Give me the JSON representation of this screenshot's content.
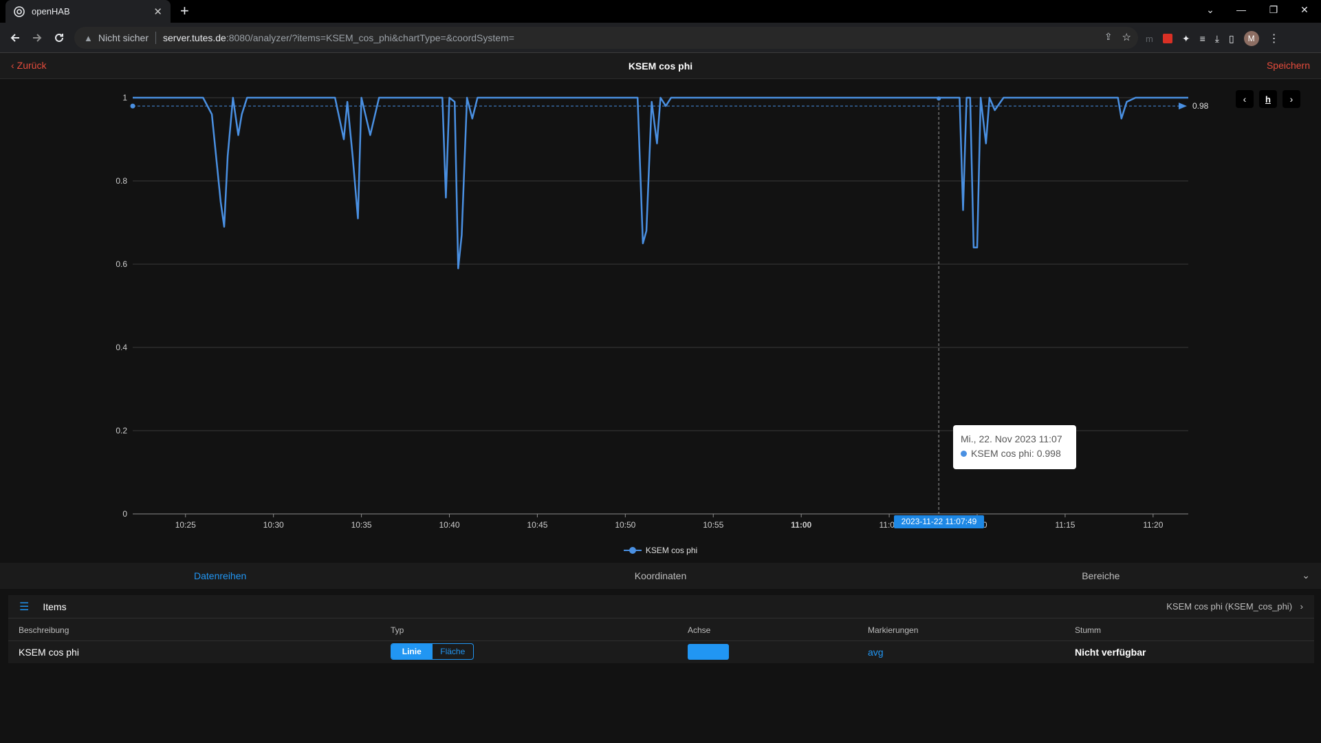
{
  "browser": {
    "tab_title": "openHAB",
    "insecure_label": "Nicht sicher",
    "url_host": "server.tutes.de",
    "url_path": ":8080/analyzer/?items=KSEM_cos_phi&chartType=&coordSystem=",
    "profile_initial": "M"
  },
  "nav": {
    "back_label": "Zurück",
    "title": "KSEM cos phi",
    "save_label": "Speichern"
  },
  "chart_controls": {
    "prev": "‹",
    "period": "h",
    "next": "›"
  },
  "chart_data": {
    "type": "line",
    "title": "",
    "xlabel": "",
    "ylabel": "",
    "ylim": [
      0,
      1
    ],
    "y_ticks": [
      "0",
      "0.2",
      "0.4",
      "0.6",
      "0.8",
      "1"
    ],
    "x_ticks": [
      "10:25",
      "10:30",
      "10:35",
      "10:40",
      "10:45",
      "10:50",
      "10:55",
      "11:00",
      "11:05",
      "11:10",
      "11:15",
      "11:20"
    ],
    "x_range": [
      "10:22",
      "11:22"
    ],
    "series": [
      {
        "name": "KSEM cos phi",
        "color": "#4a90e2",
        "x": [
          "10:22",
          "10:26",
          "10:26.5",
          "10:27",
          "10:27.2",
          "10:27.4",
          "10:27.7",
          "10:28",
          "10:28.2",
          "10:28.5",
          "10:29",
          "10:33.5",
          "10:34",
          "10:34.2",
          "10:34.5",
          "10:34.8",
          "10:35",
          "10:35.5",
          "10:36",
          "10:37",
          "10:39.6",
          "10:39.8",
          "10:40",
          "10:40.3",
          "10:40.5",
          "10:40.7",
          "10:41",
          "10:41.3",
          "10:41.6",
          "10:42",
          "10:50.7",
          "10:51",
          "10:51.2",
          "10:51.5",
          "10:51.8",
          "10:52",
          "10:52.3",
          "10:52.6",
          "10:53",
          "11:09",
          "11:09.2",
          "11:09.4",
          "11:09.6",
          "11:09.8",
          "11:10",
          "11:10.2",
          "11:10.5",
          "11:10.7",
          "11:11",
          "11:11.5",
          "11:12",
          "11:18",
          "11:18.2",
          "11:18.5",
          "11:19",
          "11:22"
        ],
        "values": [
          1.0,
          1.0,
          0.96,
          0.75,
          0.69,
          0.86,
          1.0,
          0.91,
          0.96,
          1.0,
          1.0,
          1.0,
          0.9,
          0.99,
          0.86,
          0.71,
          1.0,
          0.91,
          1.0,
          1.0,
          1.0,
          0.76,
          1.0,
          0.99,
          0.59,
          0.67,
          1.0,
          0.95,
          1.0,
          1.0,
          1.0,
          0.65,
          0.68,
          0.99,
          0.89,
          1.0,
          0.98,
          1.0,
          1.0,
          1.0,
          0.73,
          1.0,
          1.0,
          0.64,
          0.64,
          1.0,
          0.89,
          1.0,
          0.97,
          1.0,
          1.0,
          1.0,
          0.95,
          0.99,
          1.0,
          1.0
        ]
      }
    ],
    "avg_marker": {
      "label": "0.98",
      "value": 0.98
    },
    "cursor": {
      "x": "11:07:49",
      "value": 0.998
    },
    "legend": "bottom-center",
    "grid": true
  },
  "tooltip": {
    "date": "Mi., 22. Nov 2023 11:07",
    "series_label": "KSEM cos phi: 0.998"
  },
  "axis_pointer_label": "2023-11-22 11:07:49",
  "legend": {
    "label": "KSEM cos phi"
  },
  "section_tabs": [
    "Datenreihen",
    "Koordinaten",
    "Bereiche"
  ],
  "items": {
    "title": "Items",
    "selection": "KSEM cos phi (KSEM_cos_phi)",
    "columns": [
      "Beschreibung",
      "Typ",
      "Achse",
      "Markierungen",
      "Stumm"
    ],
    "row": {
      "description": "KSEM cos phi",
      "type_options": [
        "Linie",
        "Fläche"
      ],
      "type_selected": "Linie",
      "axis_color": "#2196f3",
      "markings": "avg",
      "mute": "Nicht verfügbar"
    }
  },
  "colors": {
    "accent": "#2196f3",
    "nav_link": "#e74c3c",
    "series": "#4a90e2"
  }
}
